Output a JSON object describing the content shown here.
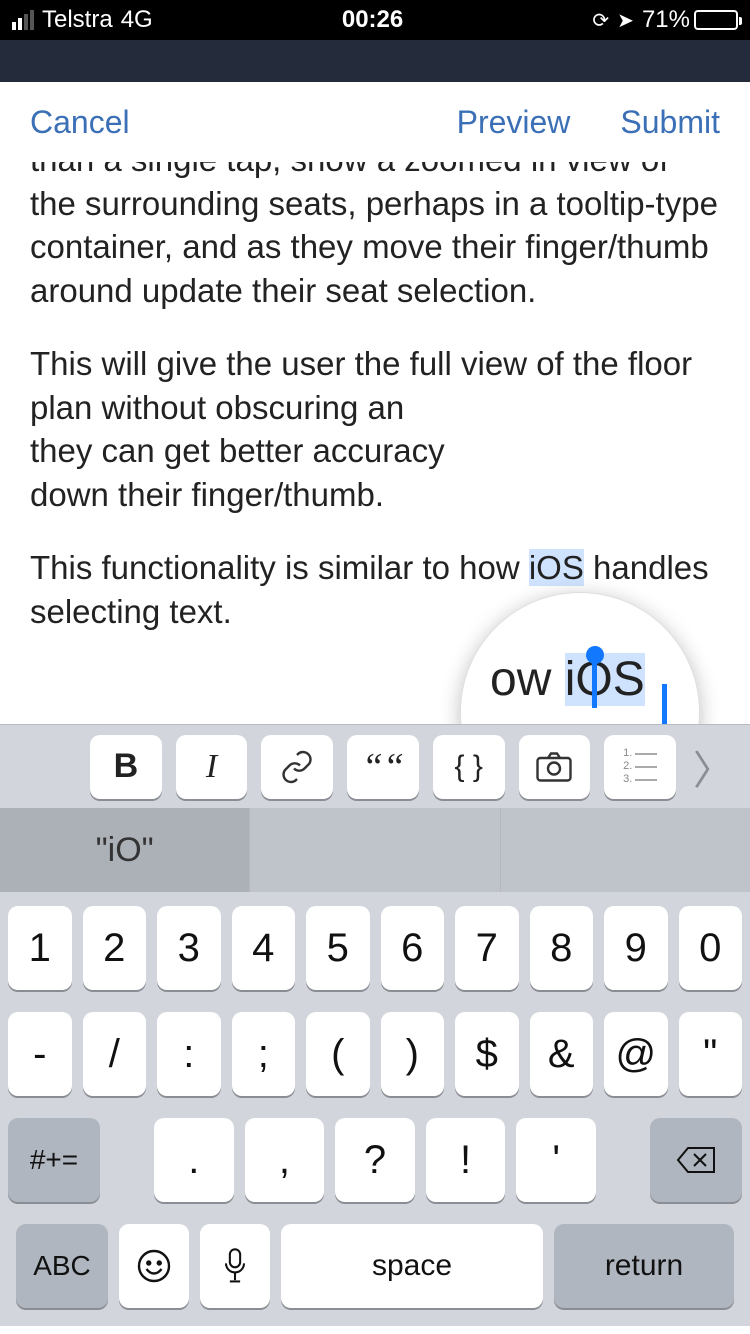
{
  "status": {
    "carrier": "Telstra",
    "network": "4G",
    "time": "00:26",
    "battery_pct": "71%"
  },
  "nav": {
    "cancel": "Cancel",
    "preview": "Preview",
    "submit": "Submit"
  },
  "editor": {
    "p1": "than a single tap, show a zoomed in view of the surrounding seats, perhaps in a tooltip-type container, and as they move their finger/thumb around update their seat selection.",
    "p2_a": "This will give the user the full view of the floor plan without obscuring an",
    "p2_b": "they can get better accuracy",
    "p2_c": "down their finger/thumb.",
    "p3_a": "This functionality is similar to how ",
    "p3_sel": "iOS",
    "p3_b": " handles selecting text."
  },
  "loupe": {
    "prefix": "ow ",
    "sel": "iOS"
  },
  "fmt": {
    "bold": "B",
    "italic": "I",
    "link": "🔗",
    "quote": "❝❞",
    "code": "{ }",
    "camera": "📷",
    "arrow": "〉"
  },
  "kb": {
    "suggestion": "\"iO\"",
    "row1": [
      "1",
      "2",
      "3",
      "4",
      "5",
      "6",
      "7",
      "8",
      "9",
      "0"
    ],
    "row2": [
      "-",
      "/",
      ":",
      ";",
      "(",
      ")",
      "$",
      "&",
      "@",
      "\""
    ],
    "shift": "#+=",
    "row3": [
      ".",
      ",",
      "?",
      "!",
      "'"
    ],
    "abc": "ABC",
    "emoji": "☺",
    "mic": "🎤",
    "space": "space",
    "return": "return"
  }
}
